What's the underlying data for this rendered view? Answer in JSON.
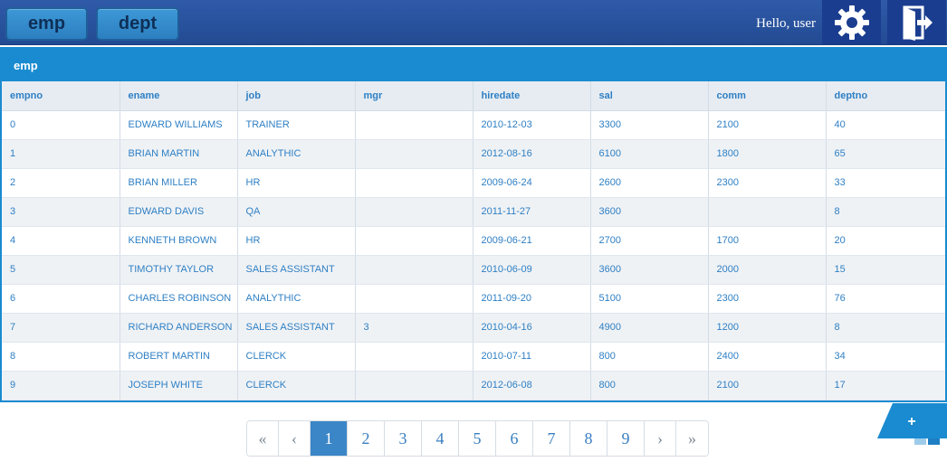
{
  "header": {
    "nav": [
      {
        "label": "emp"
      },
      {
        "label": "dept"
      }
    ],
    "greeting": "Hello, user"
  },
  "panel": {
    "title": "emp"
  },
  "table": {
    "columns": [
      "empno",
      "ename",
      "job",
      "mgr",
      "hiredate",
      "sal",
      "comm",
      "deptno"
    ],
    "rows": [
      [
        "0",
        "EDWARD WILLIAMS",
        "TRAINER",
        "",
        "2010-12-03",
        "3300",
        "2100",
        "40"
      ],
      [
        "1",
        "BRIAN MARTIN",
        "ANALYTHIC",
        "",
        "2012-08-16",
        "6100",
        "1800",
        "65"
      ],
      [
        "2",
        "BRIAN MILLER",
        "HR",
        "",
        "2009-06-24",
        "2600",
        "2300",
        "33"
      ],
      [
        "3",
        "EDWARD DAVIS",
        "QA",
        "",
        "2011-11-27",
        "3600",
        "",
        "8"
      ],
      [
        "4",
        "KENNETH BROWN",
        "HR",
        "",
        "2009-06-21",
        "2700",
        "1700",
        "20"
      ],
      [
        "5",
        "TIMOTHY TAYLOR",
        "SALES ASSISTANT",
        "",
        "2010-06-09",
        "3600",
        "2000",
        "15"
      ],
      [
        "6",
        "CHARLES ROBINSON",
        "ANALYTHIC",
        "",
        "2011-09-20",
        "5100",
        "2300",
        "76"
      ],
      [
        "7",
        "RICHARD ANDERSON",
        "SALES ASSISTANT",
        "3",
        "2010-04-16",
        "4900",
        "1200",
        "8"
      ],
      [
        "8",
        "ROBERT MARTIN",
        "CLERCK",
        "",
        "2010-07-11",
        "800",
        "2400",
        "34"
      ],
      [
        "9",
        "JOSEPH WHITE",
        "CLERCK",
        "",
        "2012-06-08",
        "800",
        "2100",
        "17"
      ]
    ]
  },
  "add_button": {
    "label": "+"
  },
  "pagination": {
    "first": "«",
    "prev": "‹",
    "pages": [
      "1",
      "2",
      "3",
      "4",
      "5",
      "6",
      "7",
      "8",
      "9"
    ],
    "active": "1",
    "next": "›",
    "last": "»"
  },
  "icons": {
    "settings": "gear-icon",
    "logout": "logout-icon",
    "grid": "grid-view-icon"
  },
  "colors": {
    "topbar": "#2f5aa8",
    "accent": "#1a8bd0",
    "text": "#2e7fc4",
    "active_page": "#3b86c7"
  }
}
